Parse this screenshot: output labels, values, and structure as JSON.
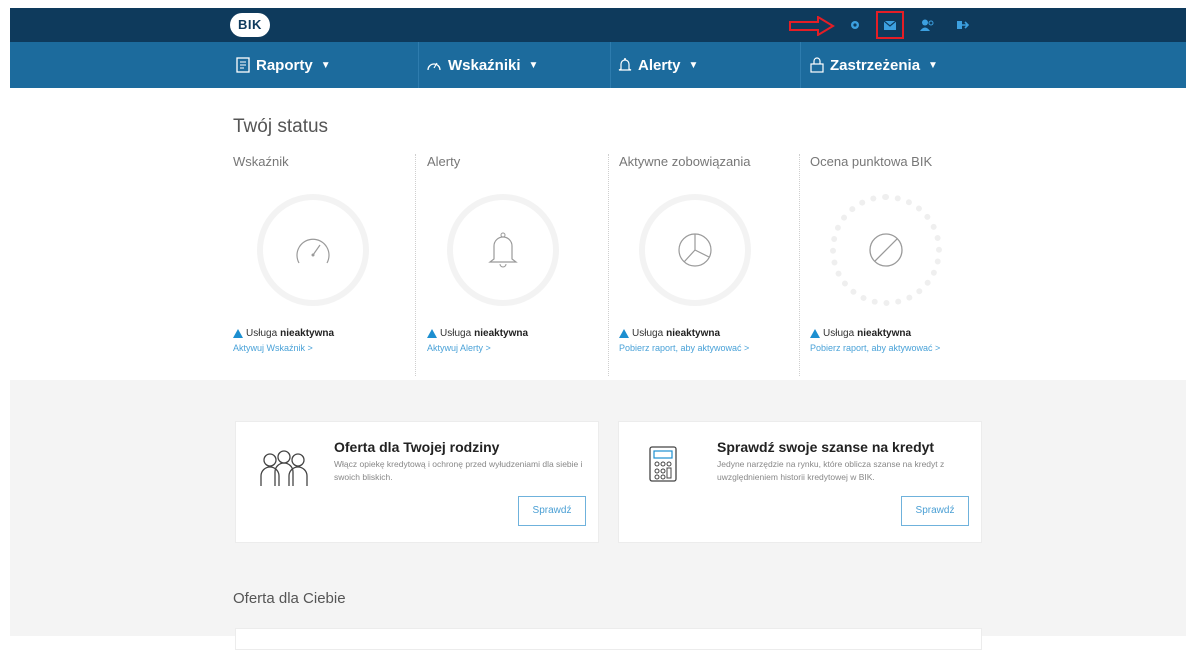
{
  "header": {
    "logo_text": "BIK",
    "icons": [
      "gear-icon",
      "mail-icon",
      "user-icon",
      "logout-icon"
    ],
    "accent_color": "#1c6b9d",
    "dark_color": "#0e3a5c",
    "annotation_color": "#e41e26"
  },
  "nav": {
    "items": [
      {
        "label": "Raporty",
        "icon": "document-icon"
      },
      {
        "label": "Wskaźniki",
        "icon": "gauge-icon"
      },
      {
        "label": "Alerty",
        "icon": "bell-icon"
      },
      {
        "label": "Zastrzeżenia",
        "icon": "lock-icon"
      }
    ]
  },
  "status": {
    "title": "Twój status",
    "service_prefix": "Usługa",
    "service_state": "nieaktywna",
    "columns": [
      {
        "title": "Wskaźnik",
        "link": "Aktywuj Wskaźnik >"
      },
      {
        "title": "Alerty",
        "link": "Aktywuj Alerty >"
      },
      {
        "title": "Aktywne zobowiązania",
        "link": "Pobierz raport, aby aktywować >"
      },
      {
        "title": "Ocena punktowa BIK",
        "link": "Pobierz raport, aby aktywować >"
      }
    ]
  },
  "cards": [
    {
      "title": "Oferta dla Twojej rodziny",
      "desc": "Włącz opiekę kredytową i ochronę przed wyłudzeniami dla siebie i swoich bliskich.",
      "button": "Sprawdź"
    },
    {
      "title": "Sprawdź swoje szanse na kredyt",
      "desc": "Jedyne narzędzie na rynku, które oblicza szanse na kredyt z uwzględnieniem historii kredytowej w BIK.",
      "button": "Sprawdź"
    }
  ],
  "offer": {
    "title": "Oferta dla Ciebie"
  }
}
